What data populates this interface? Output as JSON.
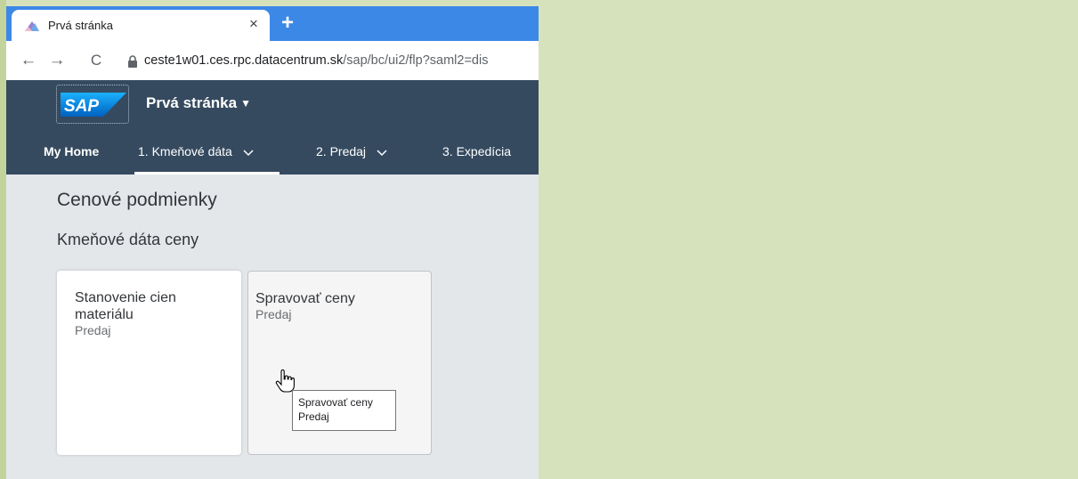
{
  "browser": {
    "tab_title": "Prvá stránka",
    "close_glyph": "×",
    "new_tab_glyph": "+",
    "back_glyph": "←",
    "forward_glyph": "→",
    "reload_glyph": "C",
    "url_host": "ceste1w01.ces.rpc.datacentrum.sk",
    "url_path": "/sap/bc/ui2/flp?saml2=dis",
    "tab_strip_color": "#3c88e7"
  },
  "shell": {
    "logo_text": "SAP",
    "app_title": "Prvá stránka",
    "caret": "▼",
    "background_color": "#354a5f",
    "menu": {
      "home": "My Home",
      "item1": "1. Kmeňové dáta",
      "item2": "2. Predaj",
      "item3": "3. Expedícia"
    }
  },
  "content": {
    "section_title": "Cenové podmienky",
    "group_title": "Kmeňové dáta ceny",
    "tiles": [
      {
        "title": "Stanovenie cien materiálu",
        "subtitle": "Predaj"
      },
      {
        "title": "Spravovať ceny",
        "subtitle": "Predaj"
      }
    ],
    "tooltip": {
      "title": "Spravovať ceny",
      "subtitle": "Predaj"
    }
  },
  "icons": {
    "favicon": "sap-fiori-favicon-icon",
    "lock": "lock-icon",
    "cursor": "hand-pointer-icon"
  },
  "page_background": "#d6e2bc"
}
